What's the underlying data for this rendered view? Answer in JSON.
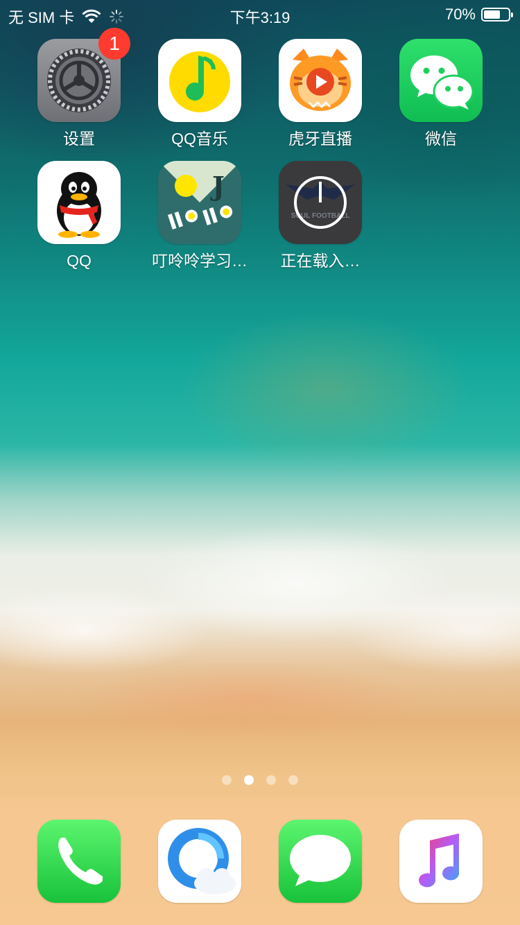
{
  "status_bar": {
    "carrier": "无 SIM 卡",
    "time": "下午3:19",
    "battery_text": "70%",
    "battery_level": 0.7
  },
  "badge_settings": "1",
  "apps": {
    "settings": "设置",
    "qqmusic": "QQ音乐",
    "huya": "虎牙直播",
    "wechat": "微信",
    "qq": "QQ",
    "dingling": "叮呤呤学习…",
    "loading": "正在载入…"
  },
  "icon_text": {
    "dingling_letter": "J",
    "loading_watermark": "SOUL FOOTBALL"
  },
  "page_indicator": {
    "count": 4,
    "active_index": 1
  },
  "dock_apps": [
    "phone",
    "browser",
    "messages",
    "music"
  ],
  "colors": {
    "badge": "#ff3b30",
    "wechat": "#1fcf5e",
    "phone": "#2bd14b",
    "messages": "#2bd14b"
  }
}
